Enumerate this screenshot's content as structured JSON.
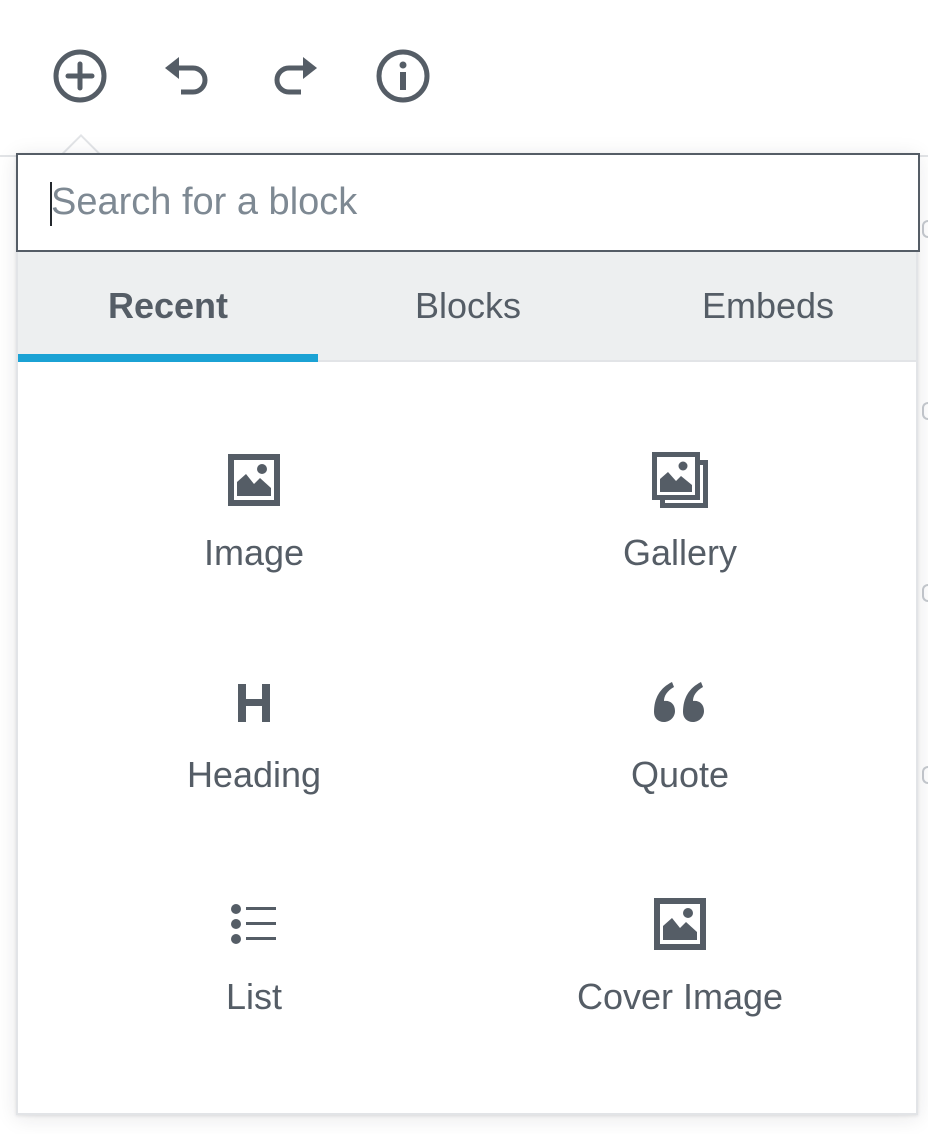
{
  "toolbar": {
    "buttons": [
      {
        "name": "add-block-button",
        "icon": "plus-circle-icon"
      },
      {
        "name": "undo-button",
        "icon": "undo-icon"
      },
      {
        "name": "redo-button",
        "icon": "redo-icon"
      },
      {
        "name": "info-button",
        "icon": "info-icon"
      }
    ]
  },
  "inserter": {
    "search": {
      "value": "",
      "placeholder": "Search for a block"
    },
    "tabs": [
      {
        "label": "Recent",
        "active": true
      },
      {
        "label": "Blocks",
        "active": false
      },
      {
        "label": "Embeds",
        "active": false
      }
    ],
    "blocks": [
      {
        "label": "Image",
        "icon": "image-icon"
      },
      {
        "label": "Gallery",
        "icon": "gallery-icon"
      },
      {
        "label": "Heading",
        "icon": "heading-icon"
      },
      {
        "label": "Quote",
        "icon": "quote-icon"
      },
      {
        "label": "List",
        "icon": "list-icon"
      },
      {
        "label": "Cover Image",
        "icon": "cover-image-icon"
      }
    ]
  },
  "colors": {
    "text": "#555d66",
    "tab_background": "#edeff0",
    "active_tab_indicator": "#1ba2d4",
    "border": "#e2e4e7",
    "search_border": "#555d66"
  }
}
